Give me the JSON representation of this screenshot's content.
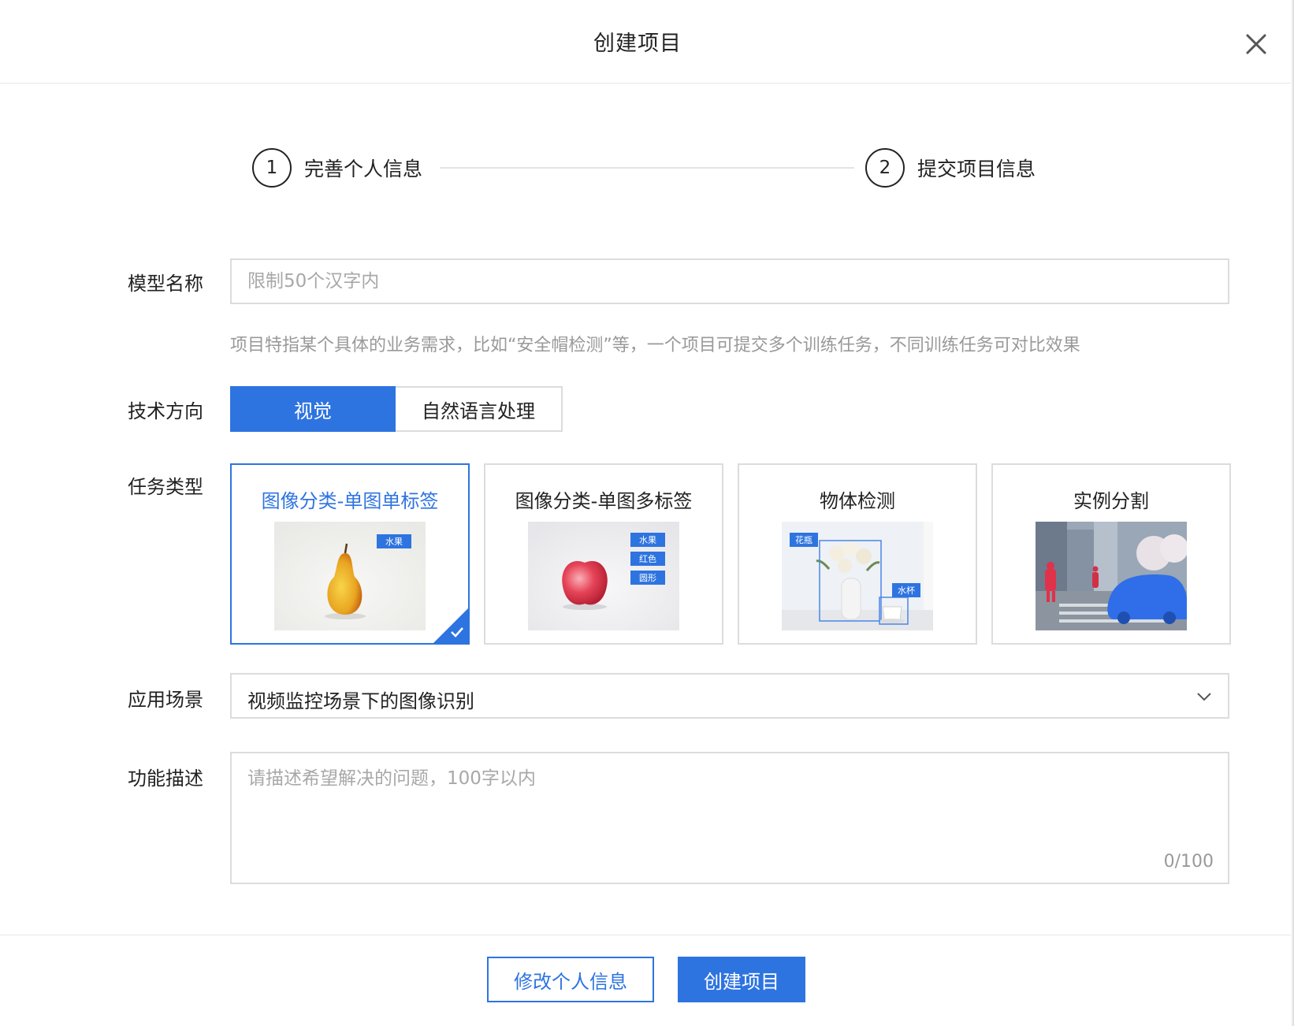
{
  "dialog": {
    "title": "创建项目"
  },
  "steps": [
    {
      "number": "1",
      "label": "完善个人信息"
    },
    {
      "number": "2",
      "label": "提交项目信息"
    }
  ],
  "form": {
    "model_name": {
      "label": "模型名称",
      "value": "",
      "placeholder": "限制50个汉字内",
      "hint": "项目特指某个具体的业务需求，比如“安全帽检测”等，一个项目可提交多个训练任务，不同训练任务可对比效果"
    },
    "tech_direction": {
      "label": "技术方向",
      "options": [
        "视觉",
        "自然语言处理"
      ],
      "selected": "视觉"
    },
    "task_type": {
      "label": "任务类型",
      "selected": "图像分类-单图单标签",
      "cards": [
        {
          "title": "图像分类-单图单标签",
          "tags": [
            "水果"
          ]
        },
        {
          "title": "图像分类-单图多标签",
          "tags": [
            "水果",
            "红色",
            "圆形"
          ]
        },
        {
          "title": "物体检测",
          "tags": [
            "花瓶",
            "水杯"
          ]
        },
        {
          "title": "实例分割",
          "tags": []
        }
      ]
    },
    "scenario": {
      "label": "应用场景",
      "value": "视频监控场景下的图像识别"
    },
    "description": {
      "label": "功能描述",
      "value": "",
      "placeholder": "请描述希望解决的问题，100字以内",
      "counter": "0/100"
    }
  },
  "footer": {
    "back_label": "修改个人信息",
    "submit_label": "创建项目"
  },
  "colors": {
    "accent": "#2e74e0",
    "border": "#dcdcdc",
    "placeholder": "#a8a8a8",
    "hint": "#999999"
  }
}
